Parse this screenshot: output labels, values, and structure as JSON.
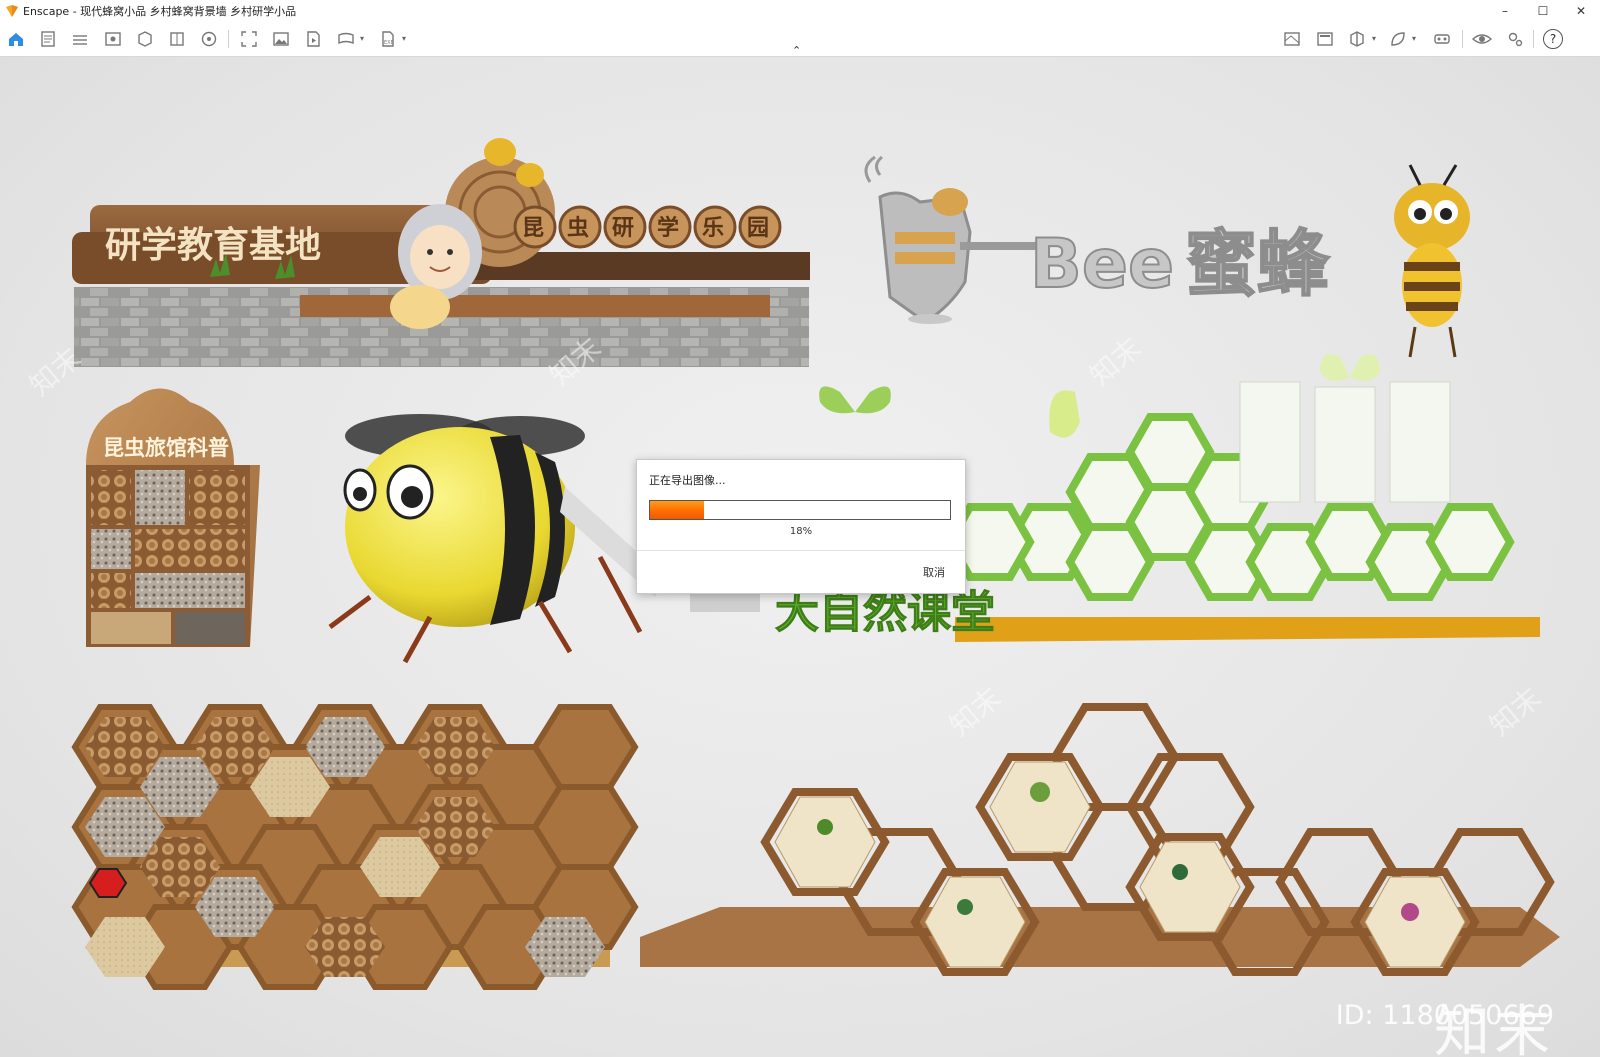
{
  "window": {
    "title": "Enscape - 现代蜂窝小品 乡村蜂窝背景墙 乡村研学小品",
    "minimize": "–",
    "maximize": "☐",
    "close": "✕"
  },
  "toolbar": {
    "icons": [
      "home-icon",
      "document-icon",
      "bim-icon",
      "view-icon",
      "asset-library-icon",
      "layers-icon",
      "visual-settings-icon",
      "capture-icon",
      "screenshot-icon",
      "video-icon",
      "panorama-icon",
      "export-icon"
    ],
    "right_icons": [
      "view-management-icon",
      "image-icon",
      "cube-icon",
      "leaf-icon",
      "vr-icon",
      "eye-icon",
      "settings-icon",
      "help-icon"
    ],
    "help": "?",
    "collapse": "⌃"
  },
  "scene": {
    "sign1": "研学教育基地",
    "sign2_chars": [
      "昆",
      "虫",
      "研",
      "学",
      "乐",
      "园"
    ],
    "bee_logo_text": "Bee",
    "bee_logo_cn": "蜜蜂",
    "hotel_title": "昆虫旅馆科普",
    "nature_class": "大自然课堂"
  },
  "dialog": {
    "message": "正在导出图像...",
    "progress": 0.18,
    "percent_label": "18%",
    "cancel_label": "取消"
  },
  "watermark": {
    "brand": "知末",
    "id": "ID: 1180050669"
  },
  "colors": {
    "accent": "#ff7a00",
    "wood": "#a47148",
    "bee_yellow": "#f2e64a",
    "green": "#7cc242"
  }
}
